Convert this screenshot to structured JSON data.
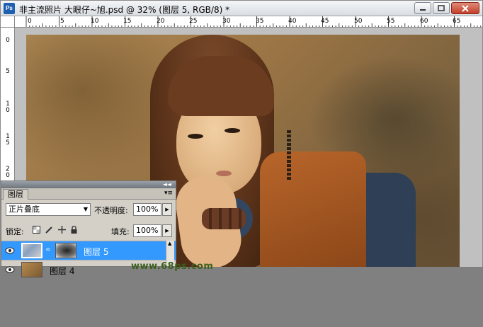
{
  "window": {
    "title": "非主流照片 大眼仔~旭.psd @ 32% (图层 5, RGB/8) *",
    "app_icon": "Ps"
  },
  "ruler": {
    "h_ticks": [
      "0",
      "5",
      "10",
      "15",
      "20",
      "25",
      "30",
      "35",
      "40",
      "45",
      "50",
      "55",
      "60",
      "65"
    ],
    "v_ticks": [
      "0",
      "5",
      "10",
      "15",
      "20"
    ]
  },
  "layers_panel": {
    "tab_label": "图层",
    "blend_mode": "正片叠底",
    "opacity_label": "不透明度:",
    "opacity_value": "100%",
    "lock_label": "锁定:",
    "fill_label": "填充:",
    "fill_value": "100%",
    "layers": [
      {
        "name": "图层 5",
        "selected": true
      },
      {
        "name": "图层 4",
        "selected": false
      }
    ]
  },
  "watermark": "www.68ps.com",
  "colors": {
    "selection": "#3399ff",
    "panel_bg": "#d4d0c8",
    "workspace": "#808080"
  }
}
